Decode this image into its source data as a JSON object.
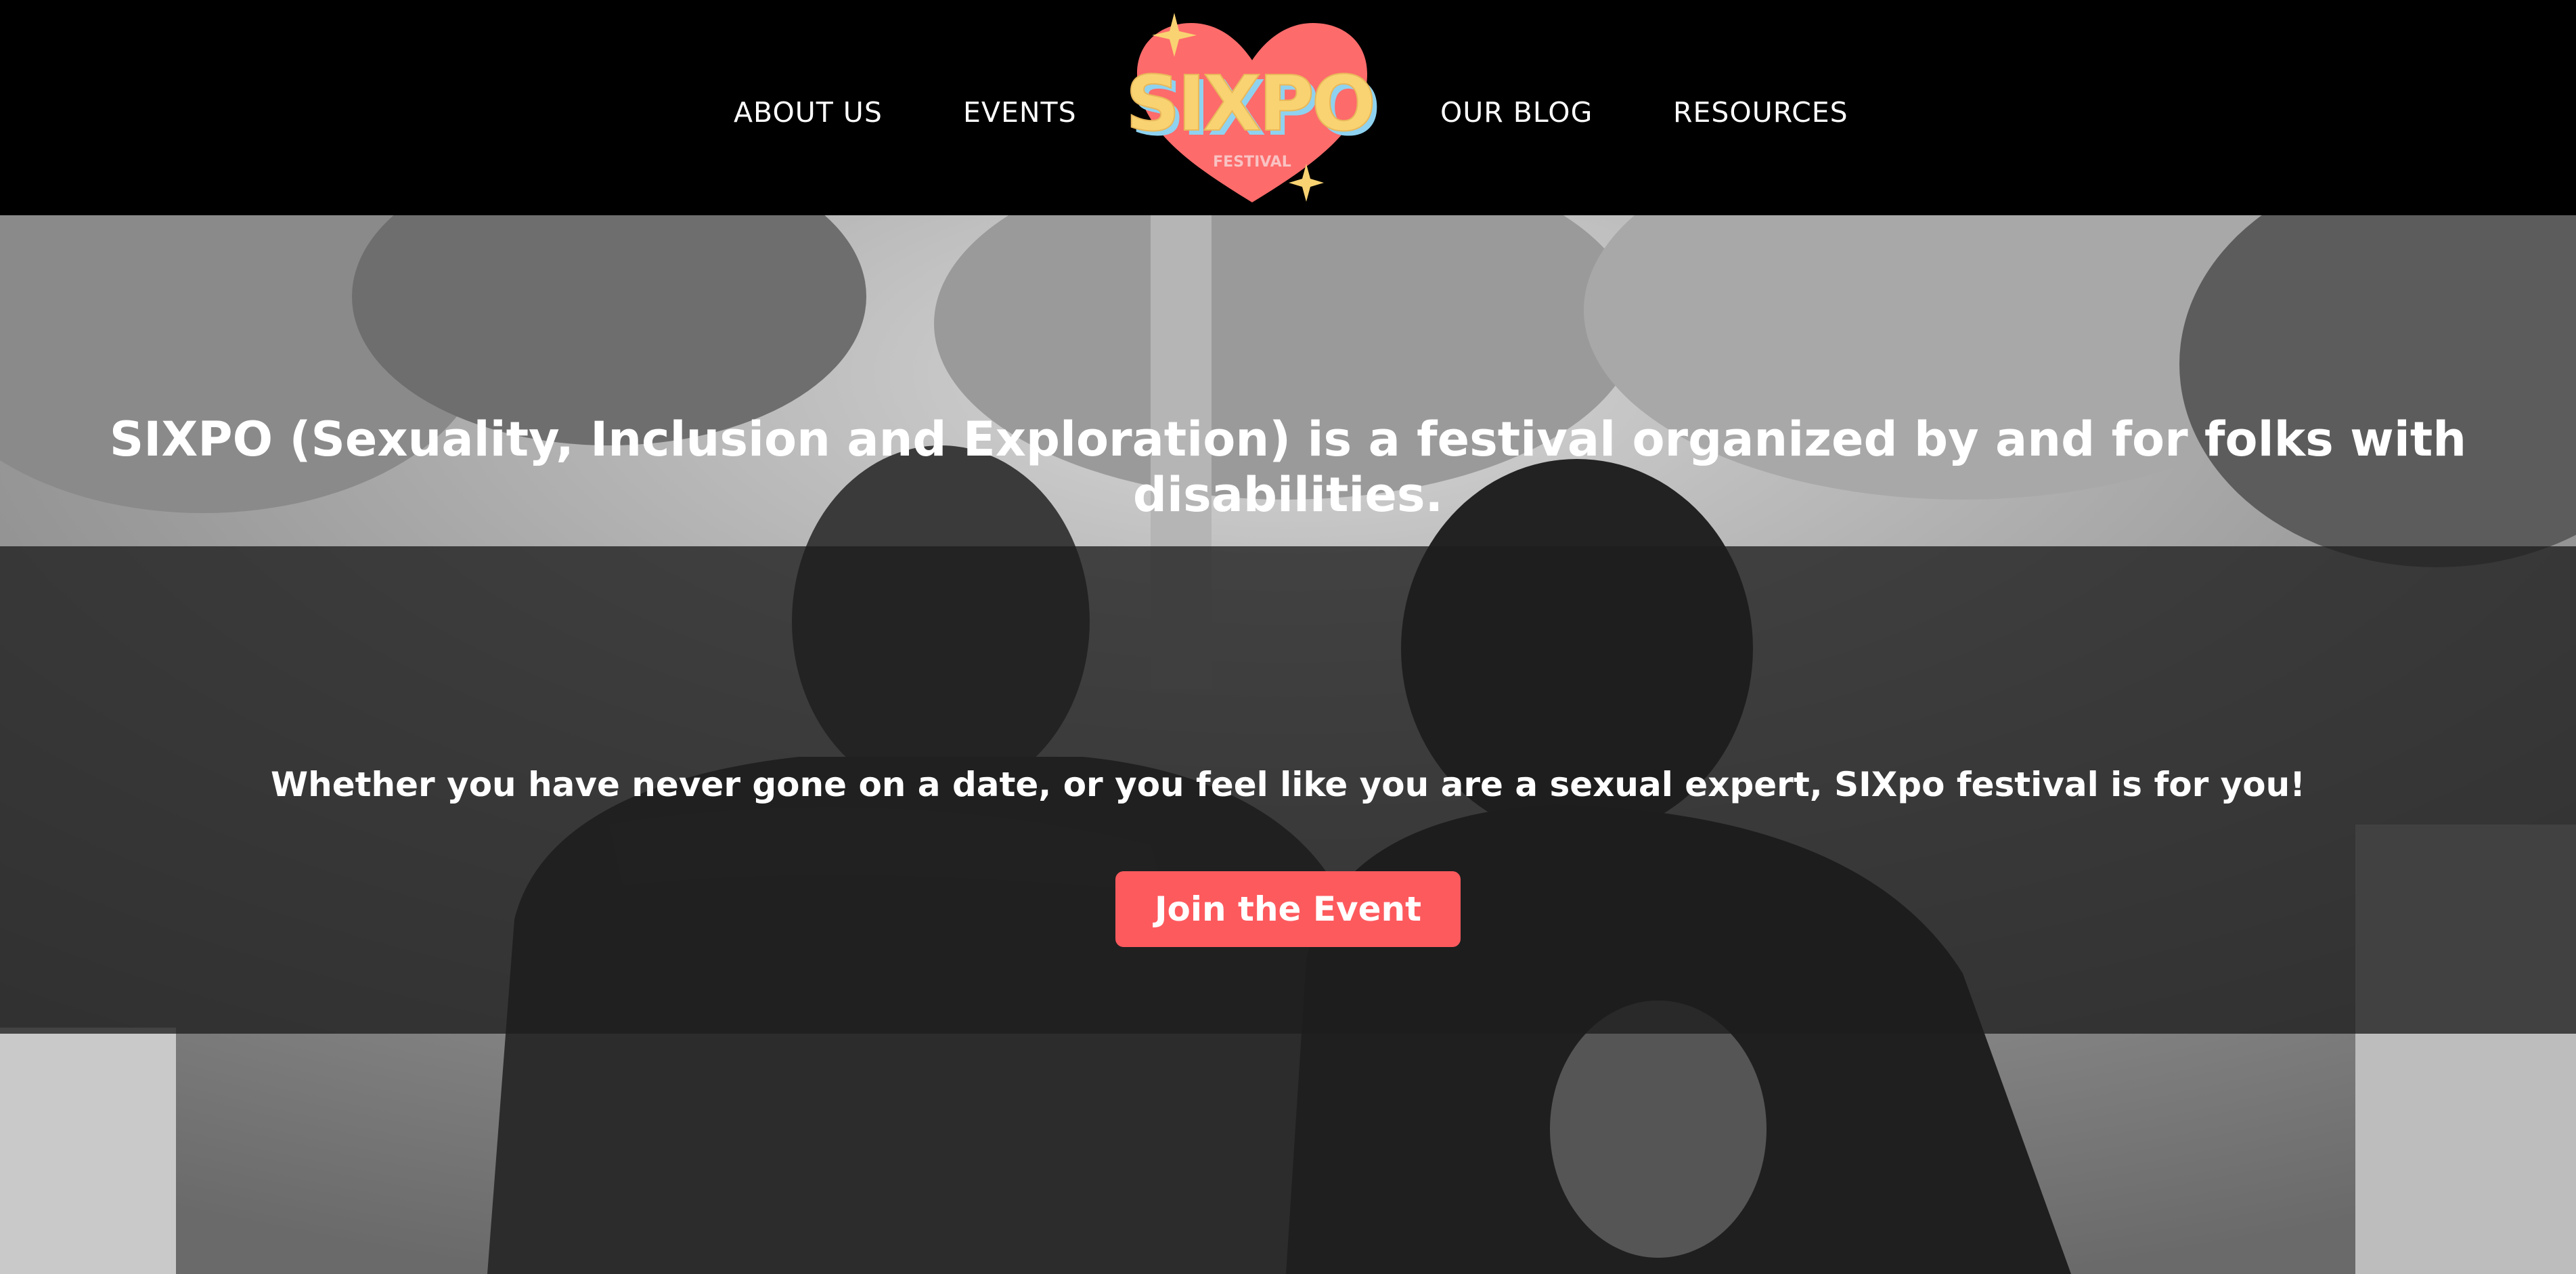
{
  "nav": {
    "items": [
      {
        "label": "ABOUT US"
      },
      {
        "label": "EVENTS"
      },
      {
        "label": "OUR BLOG"
      },
      {
        "label": "RESOURCES"
      }
    ]
  },
  "logo": {
    "text": "SIXPO",
    "subtext": "FESTIVAL",
    "icon": "heart-icon",
    "colors": {
      "heart": "#fd6b6b",
      "letters": "#f9d372",
      "letter_shadow": "#8ed2f0",
      "sparkle": "#f9d372"
    }
  },
  "hero": {
    "headline": "SIXPO (Sexuality, Inclusion and Exploration) is a festival organized by and for folks with disabilities.",
    "subheadline": "Whether you have never gone on a date, or you feel like you are a sexual expert, SIXpo festival is for you!",
    "cta_label": "Join the Event",
    "image": "black-and-white-photo-two-people-embracing",
    "colors": {
      "cta": "#fd5a5e",
      "overlay": "#1e1e1e"
    }
  }
}
